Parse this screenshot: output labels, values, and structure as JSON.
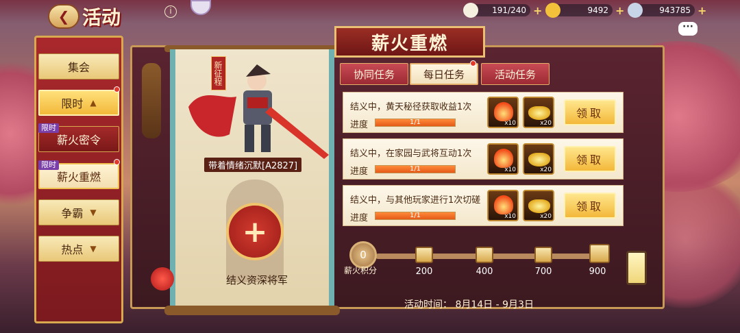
{
  "header": {
    "back_icon": "back-arrow-icon",
    "title": "活动",
    "info_label": "i"
  },
  "resources": [
    {
      "icon": "bun-icon",
      "value": "191/240",
      "color": "#f5efe0"
    },
    {
      "icon": "gold-ingot-icon",
      "value": "9492",
      "color": "#f3c23a"
    },
    {
      "icon": "coin-icon",
      "value": "943785",
      "color": "#c8d4e8"
    }
  ],
  "menu": {
    "items": [
      {
        "label": "集会",
        "style": "gold"
      },
      {
        "label": "限时",
        "style": "active",
        "arrow": "▲"
      },
      {
        "label": "薪火密令",
        "style": "sub",
        "tag": "限时"
      },
      {
        "label": "薪火重燃",
        "style": "sub-active",
        "tag": "限时"
      },
      {
        "label": "争霸",
        "style": "gold",
        "arrow": "▼"
      },
      {
        "label": "热点",
        "style": "gold",
        "arrow": "▼"
      }
    ]
  },
  "panel": {
    "banner_title": "薪火重燃",
    "new_tag": "新征程",
    "hero_name": "带着情绪沉默[A2827]",
    "slot_plus": "+",
    "slot_label": "结义资深将军"
  },
  "tabs": [
    {
      "label": "协同任务",
      "active": false
    },
    {
      "label": "每日任务",
      "active": true
    },
    {
      "label": "活动任务",
      "active": false
    }
  ],
  "tasks": [
    {
      "desc": "结义中，黄天秘径获取收益1次",
      "progress_label": "进度",
      "progress_text": "1/1",
      "progress": 1.0,
      "rewards": [
        {
          "icon": "fire-icon",
          "qty": "x10"
        },
        {
          "icon": "gold-ingot-icon",
          "qty": "x20"
        }
      ],
      "button": "领取"
    },
    {
      "desc": "结义中，在家园与武将互动1次",
      "progress_label": "进度",
      "progress_text": "1/1",
      "progress": 1.0,
      "rewards": [
        {
          "icon": "fire-icon",
          "qty": "x10"
        },
        {
          "icon": "gold-ingot-icon",
          "qty": "x20"
        }
      ],
      "button": "领取"
    },
    {
      "desc": "结义中，与其他玩家进行1次切磋",
      "progress_label": "进度",
      "progress_text": "1/1",
      "progress": 1.0,
      "rewards": [
        {
          "icon": "fire-icon",
          "qty": "x10"
        },
        {
          "icon": "gold-ingot-icon",
          "qty": "x20"
        }
      ],
      "button": "领取"
    }
  ],
  "points": {
    "current": "0",
    "label": "薪火积分",
    "milestones": [
      "200",
      "400",
      "700",
      "900"
    ]
  },
  "footer": {
    "time": "活动时间： 8月14日 - 9月3日"
  }
}
